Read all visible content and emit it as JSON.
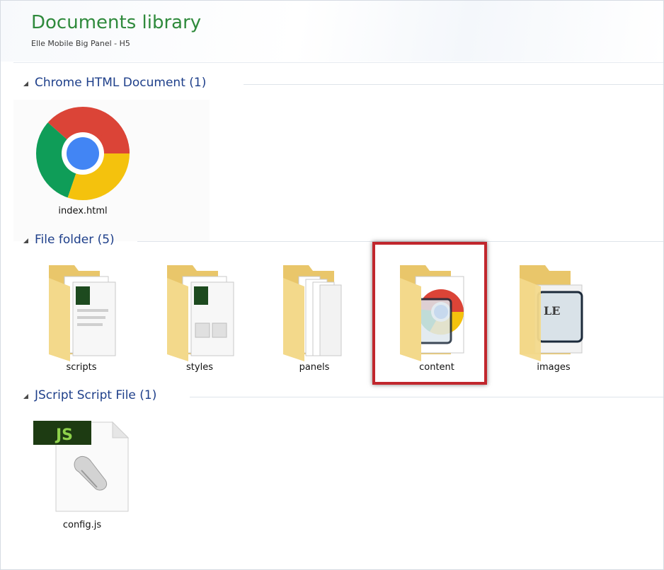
{
  "header": {
    "title": "Documents library",
    "subtitle": "Elle Mobile Big Panel - H5"
  },
  "groups": [
    {
      "label": "Chrome HTML Document (1)",
      "items": [
        {
          "name": "index.html",
          "icon": "chrome-icon"
        }
      ]
    },
    {
      "label": "File folder (5)",
      "items": [
        {
          "name": "scripts",
          "icon": "folder-icon"
        },
        {
          "name": "styles",
          "icon": "folder-icon"
        },
        {
          "name": "panels",
          "icon": "folder-icon"
        },
        {
          "name": "content",
          "icon": "folder-chrome-icon",
          "highlighted": true
        },
        {
          "name": "images",
          "icon": "folder-image-icon"
        }
      ]
    },
    {
      "label": "JScript Script File (1)",
      "items": [
        {
          "name": "config.js",
          "icon": "js-file-icon"
        }
      ]
    }
  ],
  "icons": {
    "js_badge": "JS",
    "image_badge": "LE"
  },
  "colors": {
    "title": "#2f8a3c",
    "group_label": "#1e3f8a",
    "highlight_border": "#c1272d",
    "folder_fill": "#f3d98b"
  }
}
